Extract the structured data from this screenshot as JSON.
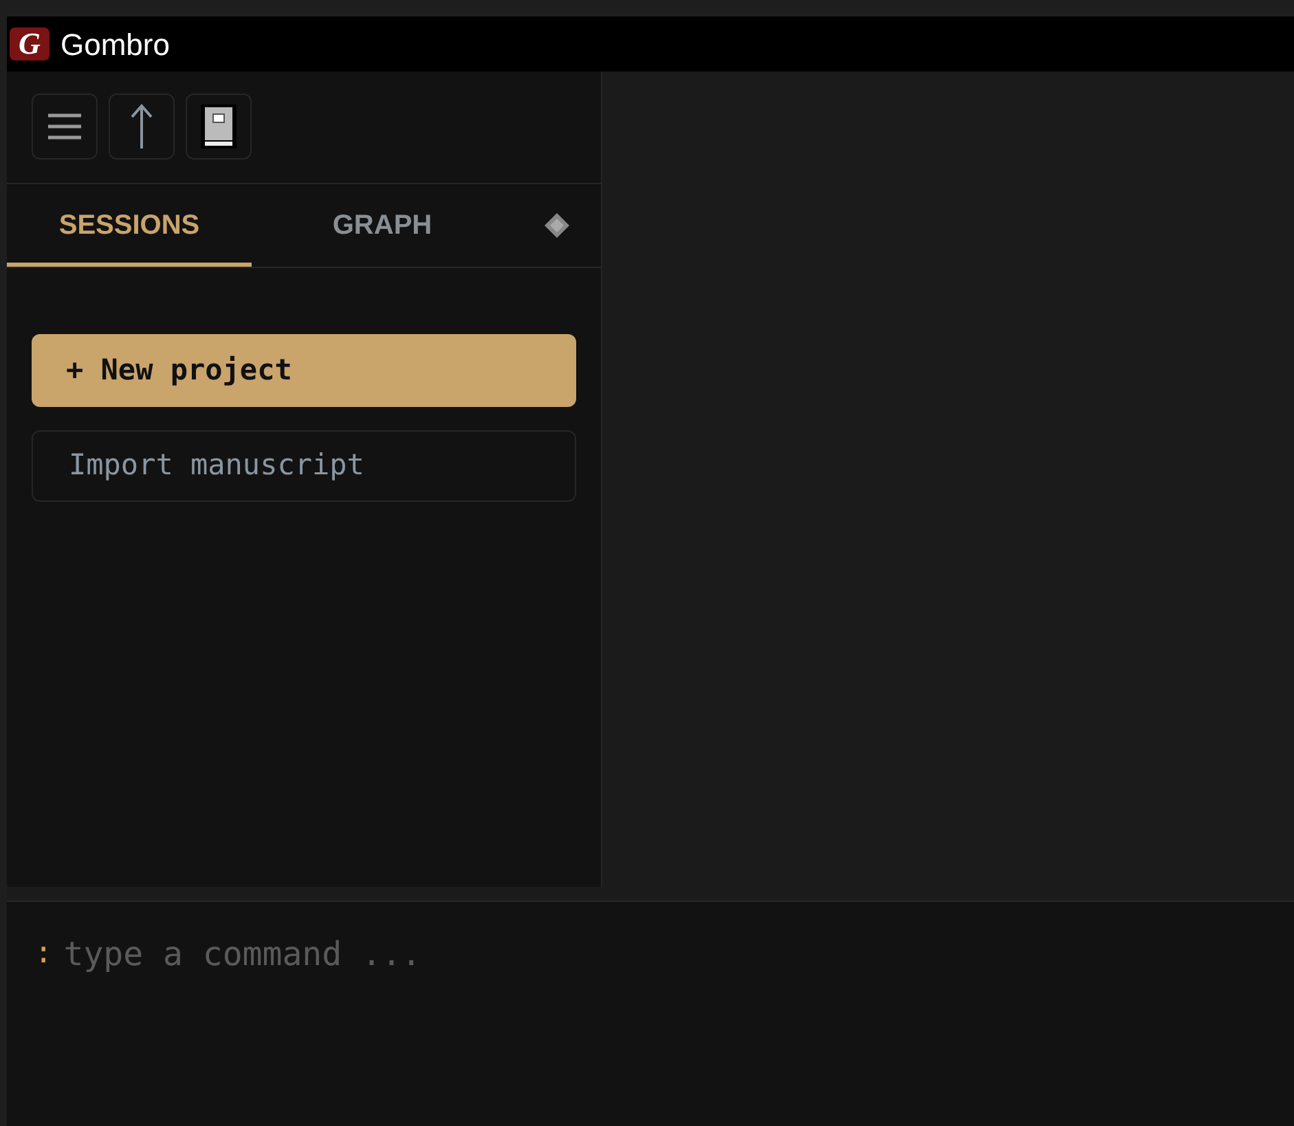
{
  "window": {
    "title": "Gombro",
    "logo": "G"
  },
  "tabs": [
    {
      "label": "SESSIONS",
      "selected": true
    },
    {
      "label": "GRAPH",
      "selected": false
    }
  ],
  "actions": [
    {
      "label": "+ New project",
      "kind": "primary"
    },
    {
      "label": "Import manuscript",
      "kind": "secondary"
    }
  ],
  "command": {
    "prompt": ":",
    "placeholder": "type a command ..."
  }
}
